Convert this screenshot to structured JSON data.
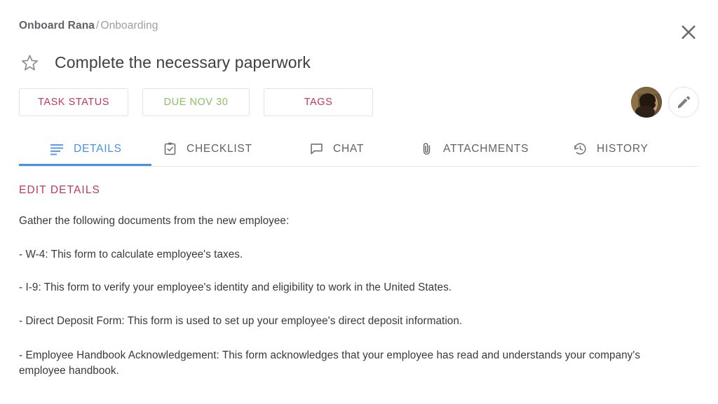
{
  "breadcrumb": {
    "parent": "Onboard Rana",
    "separator": "/",
    "current": "Onboarding"
  },
  "close_button": {
    "icon": "close-icon",
    "label": "Close"
  },
  "task": {
    "title": "Complete the necessary paperwork",
    "star_icon": "star-outline-icon"
  },
  "chips": {
    "status": "TASK STATUS",
    "due": "DUE NOV 30",
    "tags": "TAGS"
  },
  "actions": {
    "avatar_icon": "avatar",
    "edit_icon": "pencil-icon"
  },
  "tabs": [
    {
      "label": "DETAILS",
      "icon": "subject-lines-icon",
      "active": true
    },
    {
      "label": "CHECKLIST",
      "icon": "clipboard-check-icon",
      "active": false
    },
    {
      "label": "CHAT",
      "icon": "speech-bubble-icon",
      "active": false
    },
    {
      "label": "ATTACHMENTS",
      "icon": "paperclip-icon",
      "active": false
    },
    {
      "label": "HISTORY",
      "icon": "history-clock-icon",
      "active": false
    }
  ],
  "details": {
    "edit_link": "EDIT DETAILS",
    "intro": "Gather the following documents from the new employee:",
    "items": [
      "- W-4: This form to calculate employee's taxes.",
      "- I-9: This form to verify your employee's identity and eligibility to work in the United States.",
      "- Direct Deposit Form: This form is used to set up your employee's direct deposit information.",
      "- Employee Handbook Acknowledgement: This form acknowledges that your employee has read and understands your company's employee handbook."
    ]
  },
  "colors": {
    "accent_pink": "#c2395e",
    "accent_green": "#8cbf62",
    "accent_blue": "#4a90e8",
    "text": "#3c4043",
    "muted": "#9aa0a6",
    "border": "#e6e6e6"
  }
}
